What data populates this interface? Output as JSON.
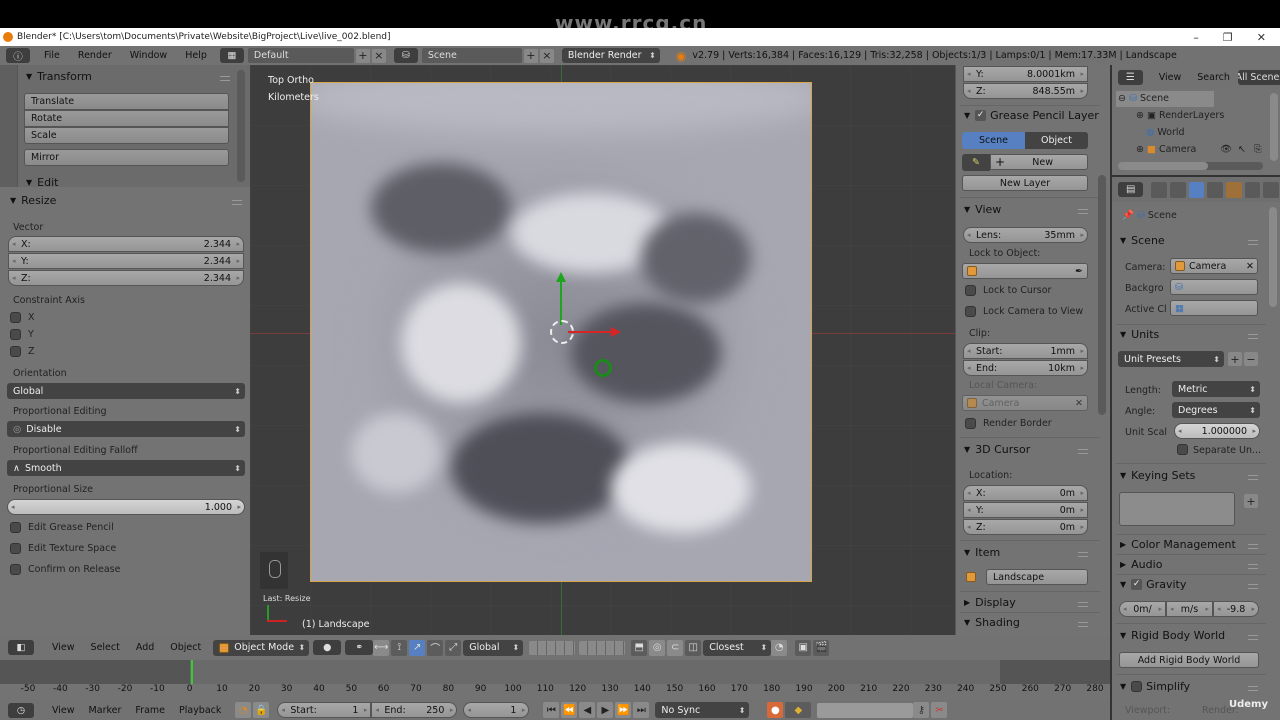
{
  "watermark": "www.rrcg.cn",
  "window": {
    "title": "Blender* [C:\\Users\\tom\\Documents\\Private\\Website\\BigProject\\Live\\live_002.blend]",
    "minimize": "–",
    "maximize": "❐",
    "close": "✕"
  },
  "menubar": {
    "menus": [
      "File",
      "Render",
      "Window",
      "Help"
    ],
    "layout": "Default",
    "scene": "Scene",
    "engine": "Blender Render",
    "stats": "v2.79 | Verts:16,384 | Faces:16,129 | Tris:32,258 | Objects:1/3 | Lamps:0/1 | Mem:17.33M | Landscape"
  },
  "toolshelf": {
    "transform_title": "Transform",
    "buttons": [
      "Translate",
      "Rotate",
      "Scale"
    ],
    "mirror": "Mirror",
    "edit_title": "Edit"
  },
  "operator": {
    "title": "Resize",
    "vector_label": "Vector",
    "vector": [
      {
        "axis": "X:",
        "value": "2.344"
      },
      {
        "axis": "Y:",
        "value": "2.344"
      },
      {
        "axis": "Z:",
        "value": "2.344"
      }
    ],
    "constraint_label": "Constraint Axis",
    "constraints": [
      "X",
      "Y",
      "Z"
    ],
    "orientation_label": "Orientation",
    "orientation": "Global",
    "prop_edit_label": "Proportional Editing",
    "prop_edit": "Disable",
    "falloff_label": "Proportional Editing Falloff",
    "falloff": "Smooth",
    "prop_size_label": "Proportional Size",
    "prop_size": "1.000",
    "options": [
      "Edit Grease Pencil",
      "Edit Texture Space",
      "Confirm on Release"
    ]
  },
  "viewport": {
    "view_name": "Top Ortho",
    "units": "Kilometers",
    "last_op": "Last: Resize",
    "object": "(1) Landscape"
  },
  "npanel": {
    "dims": [
      {
        "axis": "Y:",
        "value": "8.0001km"
      },
      {
        "axis": "Z:",
        "value": "848.55m"
      }
    ],
    "grease_title": "Grease Pencil Layer",
    "scene_tab": "Scene",
    "object_tab": "Object",
    "new_label": "New",
    "new_layer": "New Layer",
    "view_title": "View",
    "lens_label": "Lens:",
    "lens_value": "35mm",
    "lock_object_label": "Lock to Object:",
    "lock_cursor": "Lock to Cursor",
    "lock_camera": "Lock Camera to View",
    "clip_label": "Clip:",
    "clip_start_label": "Start:",
    "clip_start": "1mm",
    "clip_end_label": "End:",
    "clip_end": "10km",
    "local_camera_label": "Local Camera:",
    "local_camera": "Camera",
    "render_border": "Render Border",
    "cursor_title": "3D Cursor",
    "location_label": "Location:",
    "cursor": [
      {
        "axis": "X:",
        "value": "0m"
      },
      {
        "axis": "Y:",
        "value": "0m"
      },
      {
        "axis": "Z:",
        "value": "0m"
      }
    ],
    "item_title": "Item",
    "item_name": "Landscape",
    "display_title": "Display",
    "shading_title": "Shading"
  },
  "outliner": {
    "view": "View",
    "search": "Search",
    "filter": "All Scenes",
    "items": [
      "Scene",
      "RenderLayers",
      "World",
      "Camera"
    ]
  },
  "properties": {
    "context": "Scene",
    "scene_title": "Scene",
    "camera_label": "Camera:",
    "camera_value": "Camera",
    "background_label": "Backgro",
    "active_clip_label": "Active Cl",
    "units_title": "Units",
    "unit_presets": "Unit Presets",
    "length_label": "Length:",
    "length": "Metric",
    "angle_label": "Angle:",
    "angle": "Degrees",
    "unit_scale_label": "Unit Scal",
    "unit_scale": "1.000000",
    "separate_units": "Separate Un...",
    "keying_title": "Keying Sets",
    "color_mgmt": "Color Management",
    "audio": "Audio",
    "gravity_title": "Gravity",
    "gravity": [
      "0m/",
      "m/s",
      "-9.8"
    ],
    "rigid_title": "Rigid Body World",
    "add_rigid": "Add Rigid Body World",
    "simplify_title": "Simplify",
    "viewport_label": "Viewport:",
    "render_label": "Render:"
  },
  "vpheader": {
    "menus": [
      "View",
      "Select",
      "Add",
      "Object"
    ],
    "mode": "Object Mode",
    "orientation": "Global",
    "snap": "Closest"
  },
  "timeline": {
    "ticks": [
      "-50",
      "-40",
      "-30",
      "-20",
      "-10",
      "0",
      "10",
      "20",
      "30",
      "40",
      "50",
      "60",
      "70",
      "80",
      "90",
      "100",
      "110",
      "120",
      "130",
      "140",
      "150",
      "160",
      "170",
      "180",
      "190",
      "200",
      "210",
      "220",
      "230",
      "240",
      "250",
      "260",
      "270",
      "280"
    ],
    "menus": [
      "View",
      "Marker",
      "Frame",
      "Playback"
    ],
    "start_label": "Start:",
    "start": "1",
    "end_label": "End:",
    "end": "250",
    "current": "1",
    "sync": "No Sync"
  },
  "udemy": "Udemy"
}
